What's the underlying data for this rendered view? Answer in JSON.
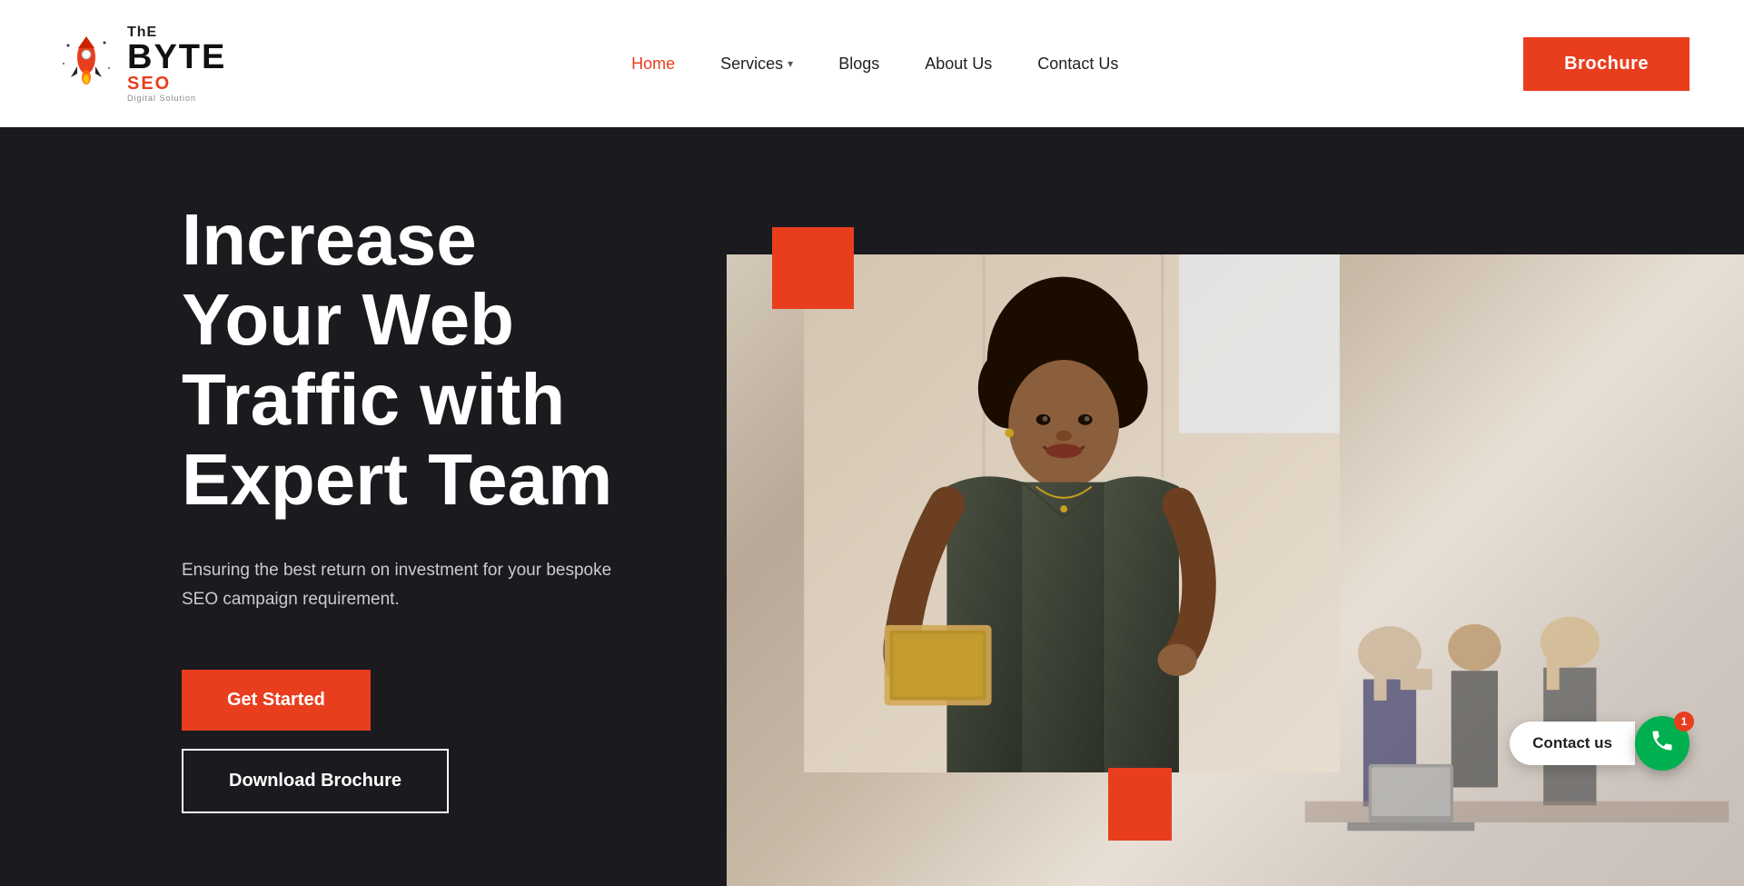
{
  "header": {
    "logo": {
      "the": "ThE",
      "byte": "BYTE",
      "seo": "SEO",
      "tagline": "Digital Solution"
    },
    "nav": {
      "home": "Home",
      "services": "Services",
      "blogs": "Blogs",
      "about_us": "About Us",
      "contact_us": "Contact Us"
    },
    "brochure_label": "Brochure"
  },
  "hero": {
    "title": "Increase Your Web Traffic with Expert Team",
    "subtitle": "Ensuring the best return on investment for your bespoke SEO campaign requirement.",
    "btn_get_started": "Get Started",
    "btn_download": "Download Brochure"
  },
  "contact_float": {
    "label": "Contact us",
    "notification_count": "1"
  },
  "colors": {
    "accent": "#e83e1e",
    "background_hero": "#1a1a1f",
    "nav_active": "#e83e1e",
    "green": "#00b050"
  },
  "icons": {
    "chevron_down": "▾",
    "phone": "📞"
  }
}
